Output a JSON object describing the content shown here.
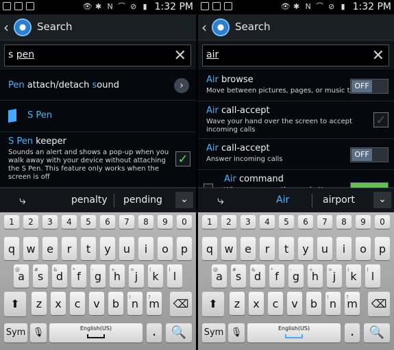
{
  "statusbar": {
    "time": "1:32 PM"
  },
  "screens": [
    {
      "id": "left",
      "header": {
        "title": "Search"
      },
      "search": {
        "query": "s pen",
        "query_plain": "s ",
        "query_highlight": "pen"
      },
      "results": [
        {
          "kind": "chevron",
          "title_parts": [
            "Pen",
            "attach/detach",
            "s",
            "ound"
          ],
          "subtitle": ""
        },
        {
          "kind": "spen",
          "title_parts": [
            "S Pen"
          ],
          "subtitle": ""
        },
        {
          "kind": "check",
          "title_parts": [
            "S Pen",
            "keeper"
          ],
          "subtitle": "Sounds an alert and shows a pop-up when you walk away with your device without attaching the S Pen. This feature only works when the screen is off"
        }
      ],
      "suggestions": [
        "penalty",
        "pending"
      ],
      "keyboard": {
        "numbers": [
          "1",
          "2",
          "3",
          "4",
          "5",
          "6",
          "7",
          "8",
          "9",
          "0"
        ],
        "row1": [
          "q",
          "w",
          "e",
          "r",
          "t",
          "y",
          "u",
          "i",
          "o",
          "p"
        ],
        "row1_sup": [
          "",
          "",
          "",
          "",
          "",
          "",
          "",
          "",
          "",
          ""
        ],
        "row2": [
          "a",
          "s",
          "d",
          "f",
          "g",
          "h",
          "j",
          "k",
          "l"
        ],
        "row2_sup": [
          "@",
          "#",
          "&",
          "*",
          "-",
          "+",
          "=",
          "(",
          ")"
        ],
        "row3": [
          "z",
          "x",
          "c",
          "v",
          "b",
          "n",
          "m"
        ],
        "row3_sup": [
          "",
          "",
          "",
          "",
          "",
          "!",
          "?"
        ],
        "sym": "Sym",
        "space": "English(US)",
        "dot": ".",
        "search": "🔍"
      }
    },
    {
      "id": "right",
      "header": {
        "title": "Search"
      },
      "search": {
        "query": "air",
        "query_plain": "air"
      },
      "results": [
        {
          "kind": "toggle",
          "title_parts": [
            "Air",
            "browse"
          ],
          "subtitle": "Move between pictures, pages, or music tracks",
          "toggle": "OFF"
        },
        {
          "kind": "check",
          "title_parts": [
            "Air",
            "call-accept"
          ],
          "subtitle": "Wave your hand over the screen to accept incoming calls"
        },
        {
          "kind": "toggle",
          "title_parts": [
            "Air",
            "call-accept"
          ],
          "subtitle": "Answer incoming calls",
          "toggle": "OFF"
        },
        {
          "kind": "partial",
          "title_parts": [
            "Air",
            "command"
          ],
          "subtitle": "When you press the pen button"
        }
      ],
      "suggestions": [
        "Air",
        "airport"
      ],
      "keyboard": {
        "numbers": [
          "1",
          "2",
          "3",
          "4",
          "5",
          "6",
          "7",
          "8",
          "9",
          "0"
        ],
        "row1": [
          "q",
          "w",
          "e",
          "r",
          "t",
          "y",
          "u",
          "i",
          "o",
          "p"
        ],
        "row1_sup": [
          "",
          "",
          "",
          "",
          "",
          "",
          "",
          "",
          "",
          ""
        ],
        "row2": [
          "a",
          "s",
          "d",
          "f",
          "g",
          "h",
          "j",
          "k",
          "l"
        ],
        "row2_sup": [
          "@",
          "#",
          "&",
          "*",
          "-",
          "+",
          "=",
          "(",
          ")"
        ],
        "row3": [
          "z",
          "x",
          "c",
          "v",
          "b",
          "n",
          "m"
        ],
        "row3_sup": [
          "",
          "",
          "",
          "",
          "",
          "!",
          "?"
        ],
        "sym": "Sym",
        "space": "English(US)",
        "dot": ".",
        "search": "🔍"
      }
    }
  ]
}
